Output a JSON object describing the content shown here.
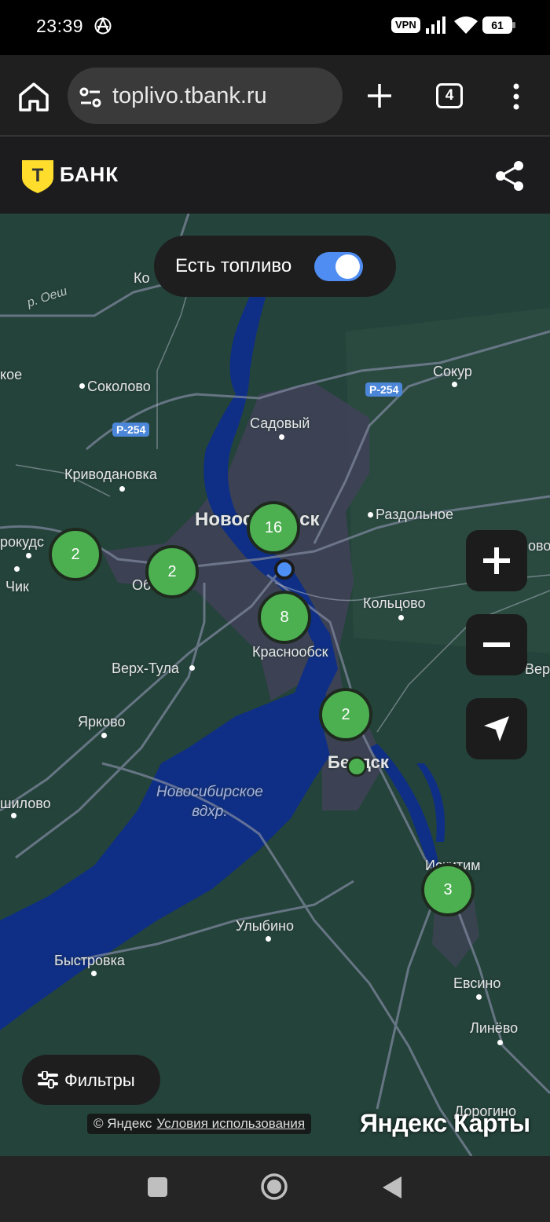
{
  "status_bar": {
    "time": "23:39",
    "vpn": "VPN",
    "battery": "61"
  },
  "browser": {
    "url": "toplivo.tbank.ru",
    "tab_count": "4"
  },
  "site": {
    "logo_letter": "Т",
    "brand": "БАНК"
  },
  "map": {
    "fuel_toggle_label": "Есть топливо",
    "fuel_toggle_on": true,
    "filters_label": "Фильтры",
    "copyright": "© Яндекс",
    "terms_link": "Условия использования",
    "provider_logo": "Яндекс Карты",
    "road_badges": [
      "Р-254",
      "Р-254"
    ],
    "places": {
      "kolyvan": "Ко",
      "oyosh": "р. Оеш",
      "koe": "кое",
      "sokolovo": "Соколово",
      "sokur": "Сокур",
      "sadovy": "Садовый",
      "krivodanovka": "Криводановка",
      "novosibirsk": "Новосибирск",
      "razdolnoe": "Раздольное",
      "prokudskoe": "рокудс",
      "chik": "Чик",
      "ob": "Об",
      "koltsovo": "Кольцово",
      "krasnoobsk": "Краснообск",
      "verkh_tula": "Верх-Тула",
      "verkh_right": "Вер",
      "borovoe_right": "ово",
      "yarkovo": "Ярково",
      "berdsk": "Бердск",
      "reservoir": "Новосибирское\nвдхр.",
      "shilovo": "шилово",
      "iskitim": "Искитим",
      "ulybino": "Улыбино",
      "bystrovka": "Быстровка",
      "evsino": "Евсино",
      "linyovo": "Линёво",
      "dorogino": "Дорогино"
    },
    "clusters": [
      {
        "count": "16"
      },
      {
        "count": "2"
      },
      {
        "count": "2"
      },
      {
        "count": "8"
      },
      {
        "count": "2"
      },
      {
        "count": "3"
      }
    ]
  },
  "icons": {
    "home": "home-icon",
    "tune": "tune-icon",
    "new_tab": "plus-icon",
    "menu": "more-vert-icon",
    "share": "share-icon",
    "zoom_in": "plus-icon",
    "zoom_out": "minus-icon",
    "locate": "navigation-arrow-icon",
    "filters": "sliders-icon"
  },
  "colors": {
    "cluster": "#4caf50",
    "user_location": "#4d8ff5",
    "toggle_on": "#4f8df3",
    "map_land": "#24433a",
    "water": "#0f2f86",
    "brand_yellow": "#ffdd2d"
  }
}
